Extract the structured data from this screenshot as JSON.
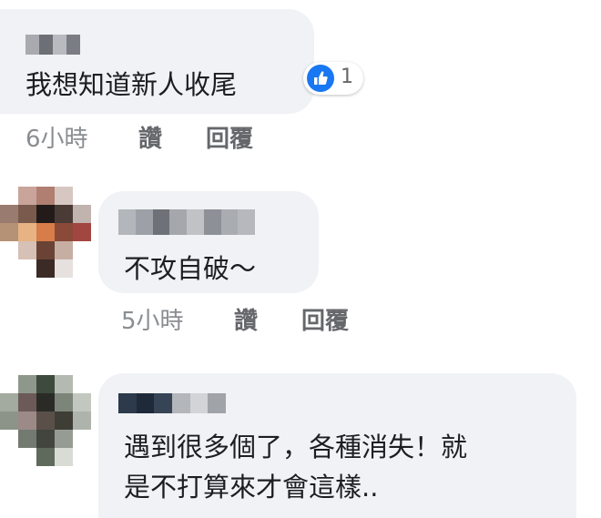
{
  "comments": [
    {
      "text_lines": [
        "我想知道新人收尾"
      ],
      "time": "6小時",
      "like_label": "讚",
      "reply_label": "回覆",
      "reaction_count": "1"
    },
    {
      "text_lines": [
        "不攻自破～"
      ],
      "time": "5小時",
      "like_label": "讚",
      "reply_label": "回覆"
    },
    {
      "text_lines": [
        "遇到很多個了，各種消失！就",
        "是不打算來才會這樣.."
      ]
    }
  ],
  "colors": {
    "bubble_bg": "#f0f2f5",
    "text": "#1c1e21",
    "meta": "#8a8d91",
    "like_blue": "#1877f2"
  },
  "icons": {
    "reaction": "thumbs-up-icon"
  }
}
